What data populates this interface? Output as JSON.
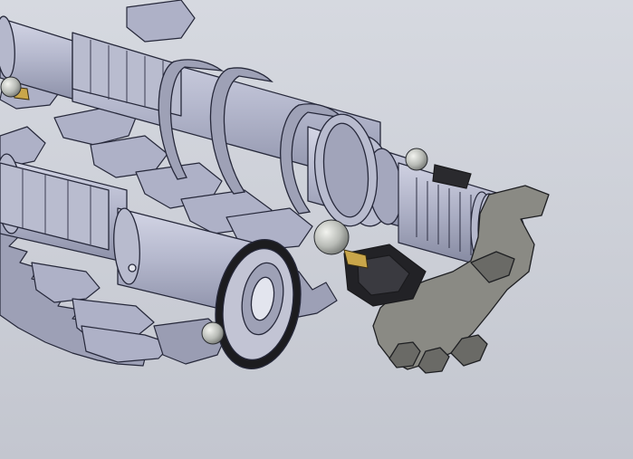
{
  "viewport": {
    "background_top": "#d6d9e0",
    "background_bottom": "#c3c6cf"
  },
  "colors": {
    "steel_light": "#c4c6d8",
    "steel_mid": "#a9acc2",
    "steel_dark": "#7f8399",
    "edge": "#26283a",
    "sprocket": "#8a8a84",
    "sprocket_dark": "#6a6a66",
    "brass": "#c9a64a",
    "rubber": "#1c1c1f",
    "ball": "#b9bcb8"
  },
  "model": {
    "parts": [
      {
        "name": "upper-shaft",
        "type": "shaft"
      },
      {
        "name": "lower-shaft",
        "type": "shaft"
      },
      {
        "name": "output-spline",
        "type": "splined-shaft"
      },
      {
        "name": "sprocket",
        "type": "sprocket"
      },
      {
        "name": "snap-rings",
        "type": "ring"
      },
      {
        "name": "oil-seal",
        "type": "seal"
      },
      {
        "name": "detent-balls",
        "type": "ball"
      },
      {
        "name": "gear-dogs",
        "type": "gear"
      }
    ]
  }
}
